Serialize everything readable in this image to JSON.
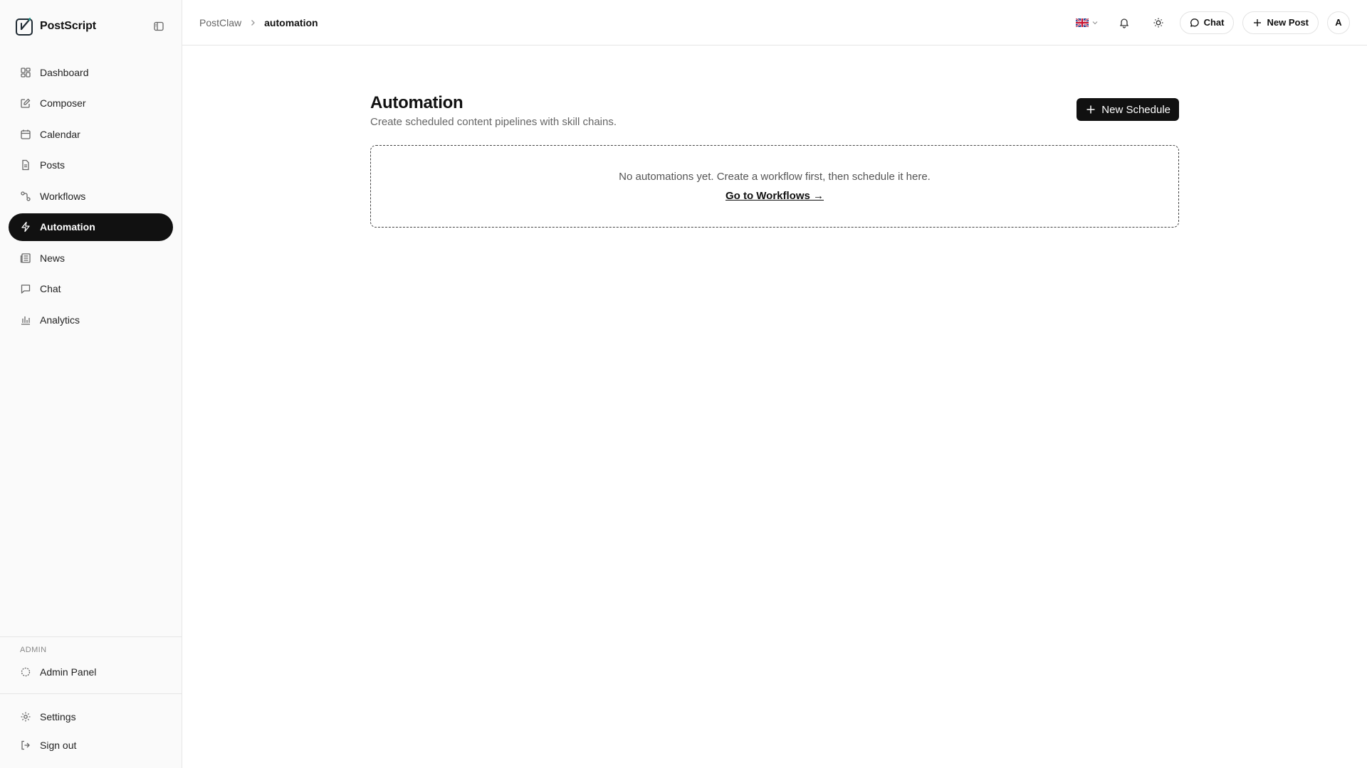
{
  "brand": {
    "name": "PostScript",
    "logo_icon": "postscript-logo-icon"
  },
  "sidebar": {
    "items": [
      {
        "label": "Dashboard",
        "icon": "dashboard-icon"
      },
      {
        "label": "Composer",
        "icon": "compose-icon"
      },
      {
        "label": "Calendar",
        "icon": "calendar-icon"
      },
      {
        "label": "Posts",
        "icon": "document-icon"
      },
      {
        "label": "Workflows",
        "icon": "workflow-icon"
      },
      {
        "label": "Automation",
        "icon": "lightning-icon",
        "active": true
      },
      {
        "label": "News",
        "icon": "newspaper-icon"
      },
      {
        "label": "Chat",
        "icon": "chat-icon"
      },
      {
        "label": "Analytics",
        "icon": "bar-chart-icon"
      }
    ],
    "admin_label": "ADMIN",
    "admin_items": [
      {
        "label": "Admin Panel",
        "icon": "admin-icon"
      }
    ],
    "bottom_items": [
      {
        "label": "Settings",
        "icon": "gear-icon"
      },
      {
        "label": "Sign out",
        "icon": "sign-out-icon"
      }
    ]
  },
  "topbar": {
    "breadcrumb": {
      "root": "PostClaw",
      "current": "automation"
    },
    "language_flag": "uk-flag-icon",
    "chat_label": "Chat",
    "new_post_label": "New Post",
    "avatar_initial": "A"
  },
  "page": {
    "title": "Automation",
    "subtitle": "Create scheduled content pipelines with skill chains.",
    "new_schedule_label": "New Schedule",
    "empty_text": "No automations yet. Create a workflow first, then schedule it here.",
    "empty_link": "Go to Workflows →"
  },
  "colors": {
    "accent": "#111111",
    "sidebar_bg": "#fafafa",
    "border": "#e6e6e6",
    "muted_text": "#666666"
  }
}
